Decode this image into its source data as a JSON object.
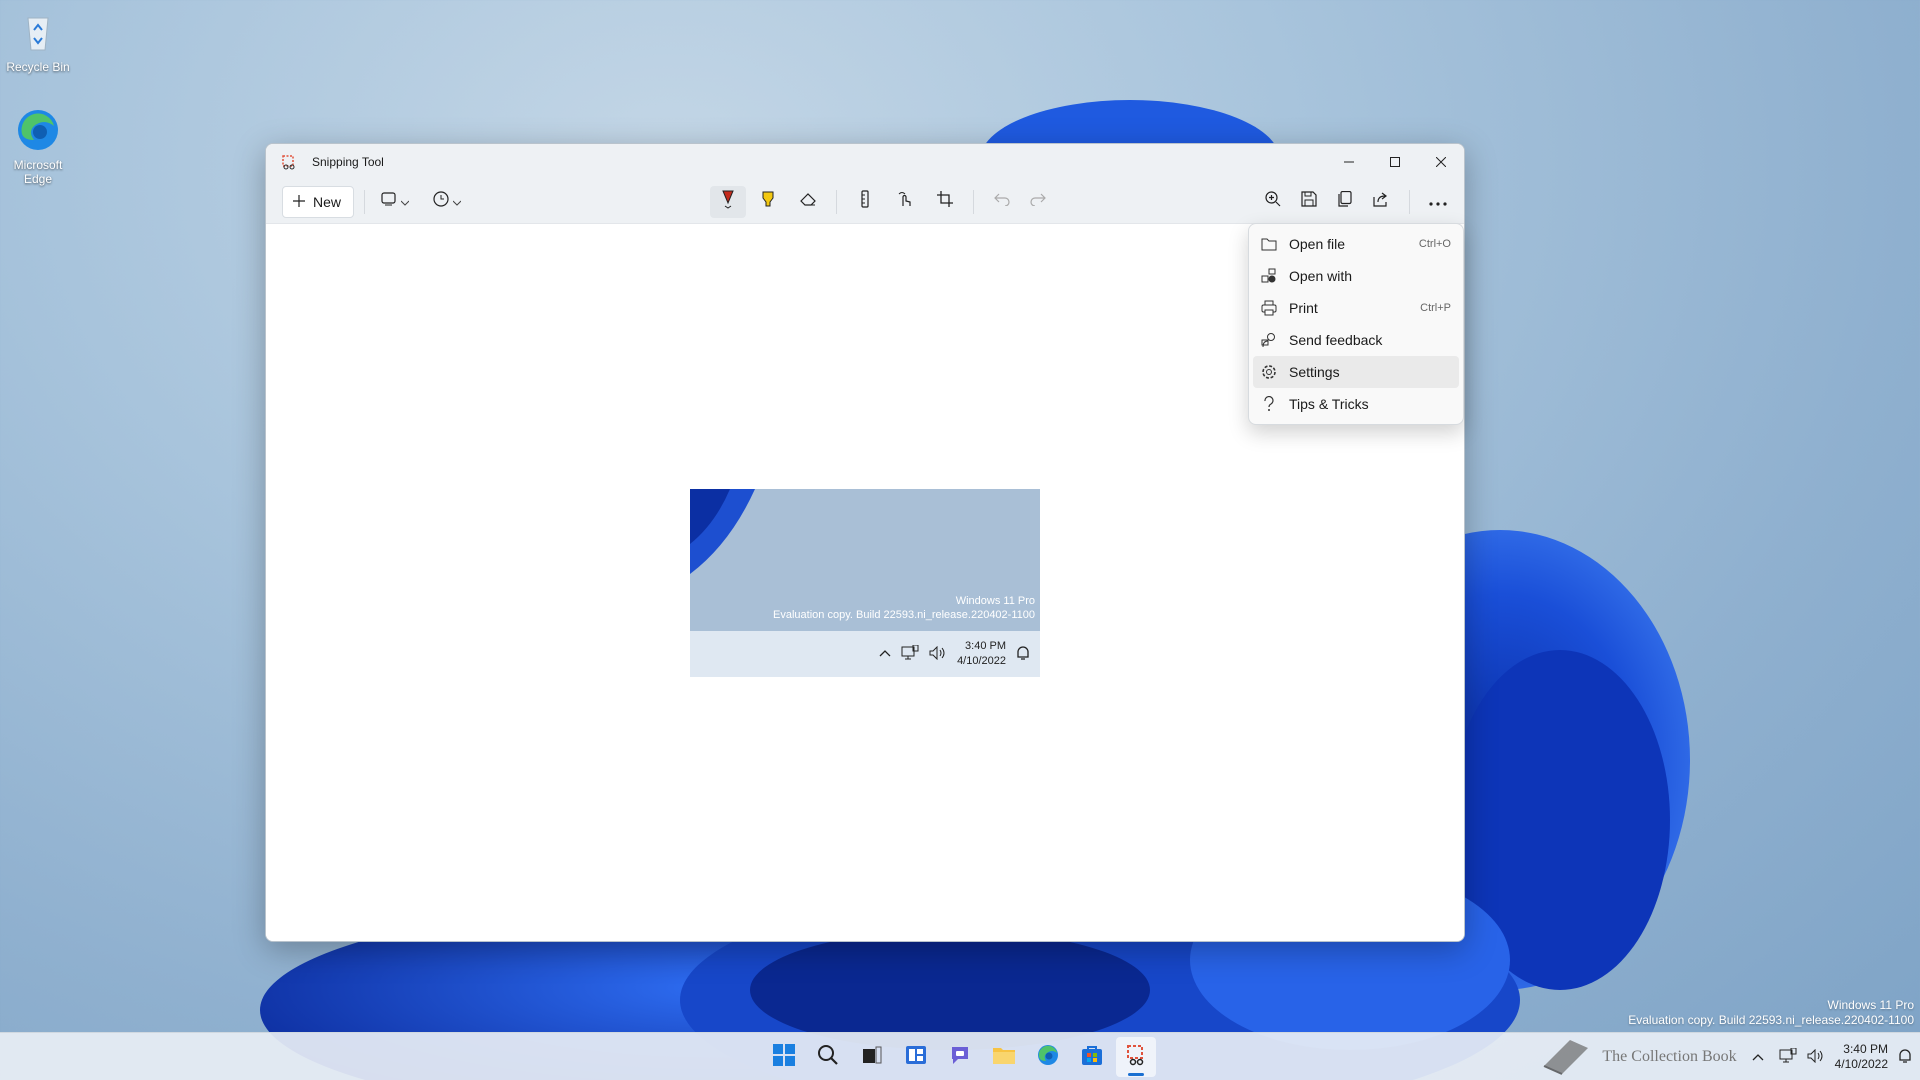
{
  "desktop": {
    "icons": [
      {
        "label": "Recycle Bin"
      },
      {
        "label": "Microsoft Edge"
      }
    ],
    "watermark": {
      "line1": "Windows 11 Pro",
      "line2": "Evaluation copy. Build 22593.ni_release.220402-1100"
    }
  },
  "window": {
    "title": "Snipping Tool",
    "toolbar": {
      "new_label": "New"
    },
    "menu": {
      "items": [
        {
          "label": "Open file",
          "shortcut": "Ctrl+O",
          "icon": "folder-icon"
        },
        {
          "label": "Open with",
          "shortcut": "",
          "icon": "apps-icon"
        },
        {
          "label": "Print",
          "shortcut": "Ctrl+P",
          "icon": "printer-icon"
        },
        {
          "label": "Send feedback",
          "shortcut": "",
          "icon": "feedback-icon"
        },
        {
          "label": "Settings",
          "shortcut": "",
          "icon": "gear-icon"
        },
        {
          "label": "Tips & Tricks",
          "shortcut": "",
          "icon": "question-icon"
        }
      ]
    },
    "snip": {
      "watermark_line1": "Windows 11 Pro",
      "watermark_line2": "Evaluation copy. Build 22593.ni_release.220402-1100",
      "time": "3:40 PM",
      "date": "4/10/2022"
    }
  },
  "taskbar": {
    "time": "3:40 PM",
    "date": "4/10/2022",
    "watermark_text": "The Collection Book"
  },
  "colors": {
    "accent": "#1a6fd1",
    "pen_red": "#c42b1c",
    "highlighter_yellow": "#f2c811"
  }
}
